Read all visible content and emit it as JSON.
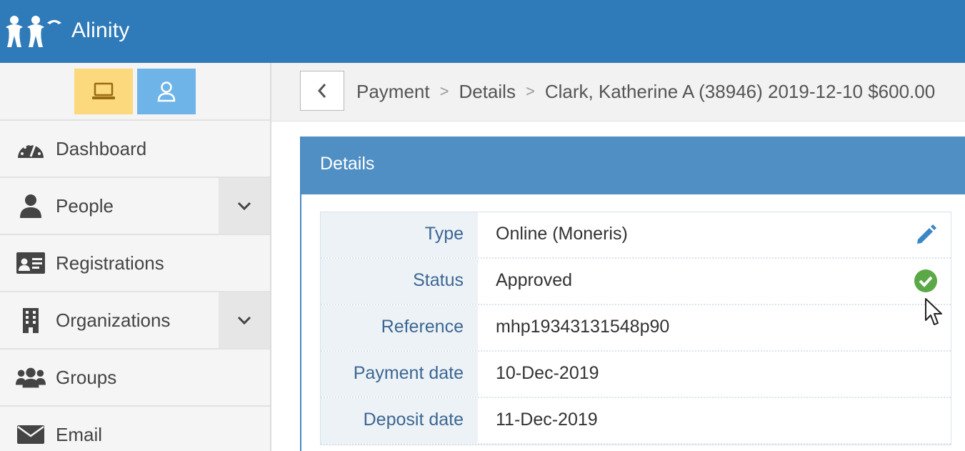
{
  "app": {
    "title": "Alinity"
  },
  "sidebar": {
    "modes": [
      {
        "name": "desktop",
        "icon": "laptop-icon"
      },
      {
        "name": "user",
        "icon": "user-outline-icon"
      }
    ],
    "items": [
      {
        "label": "Dashboard",
        "icon": "dashboard-gauge-icon",
        "expandable": false
      },
      {
        "label": "People",
        "icon": "person-icon",
        "expandable": true
      },
      {
        "label": "Registrations",
        "icon": "id-card-icon",
        "expandable": false
      },
      {
        "label": "Organizations",
        "icon": "building-icon",
        "expandable": true
      },
      {
        "label": "Groups",
        "icon": "users-group-icon",
        "expandable": false
      },
      {
        "label": "Email",
        "icon": "envelope-icon",
        "expandable": false
      }
    ]
  },
  "breadcrumb": {
    "items": [
      "Payment",
      "Details",
      "Clark, Katherine A (38946) 2019-12-10 $600.00"
    ],
    "separator": ">"
  },
  "panel": {
    "title": "Details",
    "rows": [
      {
        "label": "Type",
        "value": "Online (Moneris)",
        "icon": "pencil-edit-icon"
      },
      {
        "label": "Status",
        "value": "Approved",
        "icon": "check-circle-icon"
      },
      {
        "label": "Reference",
        "value": "mhp19343131548p90"
      },
      {
        "label": "Payment date",
        "value": "10-Dec-2019"
      },
      {
        "label": "Deposit date",
        "value": "11-Dec-2019"
      }
    ]
  },
  "colors": {
    "topbar": "#2f7ab8",
    "panel_header": "#4f8fc4",
    "desktop_mode": "#fcd97d",
    "user_mode": "#6eb4e8",
    "label_text": "#3c6793",
    "approved_green": "#5aa846"
  }
}
